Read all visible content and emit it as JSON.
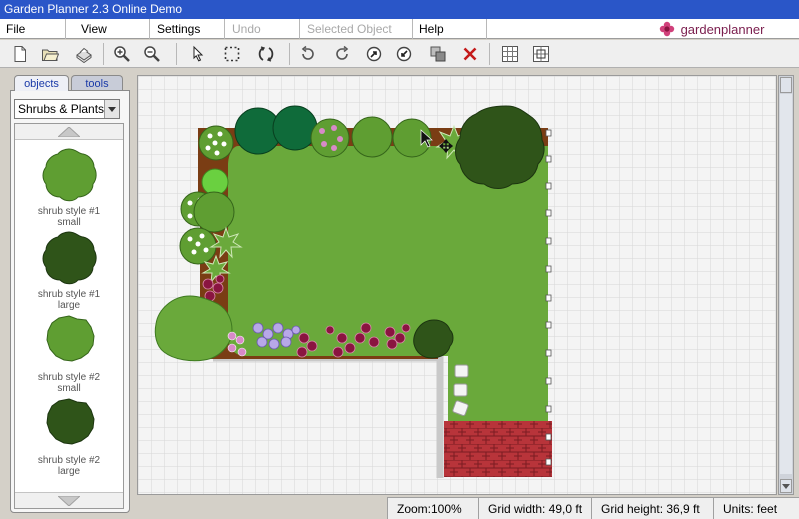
{
  "window": {
    "title": "Garden Planner 2.3 Online Demo"
  },
  "menu": {
    "items": [
      {
        "label": "File",
        "disabled": false
      },
      {
        "label": "View",
        "disabled": false
      },
      {
        "label": "Settings",
        "disabled": false
      },
      {
        "label": "Undo",
        "disabled": true
      },
      {
        "label": "Selected Object",
        "disabled": true
      },
      {
        "label": "Help",
        "disabled": false
      }
    ],
    "logo_text": "gardenplanner"
  },
  "toolbar": {
    "buttons": [
      {
        "icon": "new-file-icon"
      },
      {
        "icon": "open-folder-icon"
      },
      {
        "icon": "print-icon"
      },
      {
        "icon": "zoom-in-icon"
      },
      {
        "icon": "zoom-out-icon"
      },
      {
        "icon": "select-arrow-icon"
      },
      {
        "icon": "marquee-select-icon"
      },
      {
        "icon": "rotate-icon"
      },
      {
        "icon": "rotate-left-icon"
      },
      {
        "icon": "rotate-right-icon"
      },
      {
        "icon": "bring-forward-icon"
      },
      {
        "icon": "send-backward-icon"
      },
      {
        "icon": "group-icon"
      },
      {
        "icon": "delete-icon"
      },
      {
        "icon": "grid-icon"
      },
      {
        "icon": "snap-grid-icon"
      }
    ],
    "delete_color": "#c41a1a"
  },
  "panel": {
    "tabs": [
      {
        "label": "objects",
        "active": true
      },
      {
        "label": "tools",
        "active": false
      }
    ],
    "category": "Shrubs & Plants",
    "items": [
      {
        "label_line1": "shrub style #1",
        "label_line2": "small",
        "color": "#5f9e32",
        "shape": "style1"
      },
      {
        "label_line1": "shrub style #1",
        "label_line2": "large",
        "color": "#2f5419",
        "shape": "style1"
      },
      {
        "label_line1": "shrub style #2",
        "label_line2": "small",
        "color": "#5f9e32",
        "shape": "style2"
      },
      {
        "label_line1": "shrub style #2",
        "label_line2": "large",
        "color": "#2f5419",
        "shape": "style2"
      }
    ]
  },
  "colors": {
    "lawn": "#6aa93b",
    "bed": "#7a3d14",
    "brick": "#b8343a",
    "path": "#c8c8c8",
    "grid_line": "#d8d8d8",
    "shrub_light": "#5f9e32",
    "shrub_dark": "#2f5419",
    "shrub_evergreen": "#0f6b3a",
    "flower_white": "#ffffff",
    "flower_pink": "#d88ac8",
    "flower_lavender": "#b8a8e8",
    "flower_crimson": "#8a1440"
  },
  "status": {
    "zoom": "Zoom:100%",
    "grid_width": "Grid width: 49,0 ft",
    "grid_height": "Grid height: 36,9 ft",
    "units": "Units: feet"
  }
}
